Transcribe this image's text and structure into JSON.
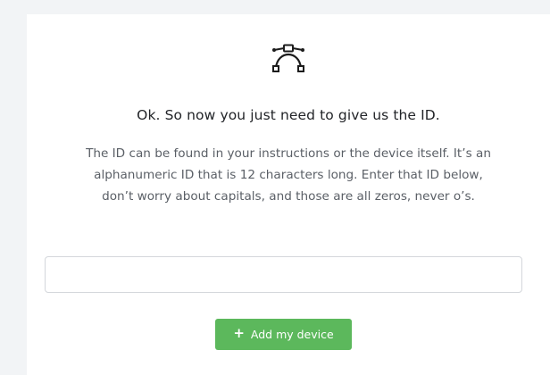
{
  "card": {
    "icon": "bezier-curve-icon",
    "headline": "Ok. So now you just need to give us the ID.",
    "description_lines": [
      "The ID can be found in your instructions or the device itself. It’s an",
      "alphanumeric ID that is 12 characters long. Enter that ID below,",
      "don’t worry about capitals, and those are all zeros, never o’s."
    ],
    "id_input": {
      "value": "",
      "placeholder": ""
    },
    "add_button": {
      "icon": "plus-icon",
      "label": "Add my device"
    }
  },
  "colors": {
    "button_green": "#5cb85c",
    "background": "#f2f4f6",
    "card": "#ffffff"
  }
}
